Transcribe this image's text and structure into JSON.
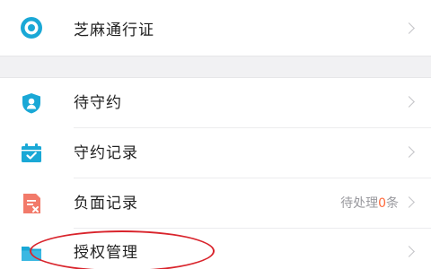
{
  "colors": {
    "accent": "#1aa8d6",
    "danger": "#f27a6a",
    "annotation": "#d9242c",
    "pending_count": "#ff6a3c"
  },
  "top_item": {
    "label": "芝麻通行证",
    "icon": "zhima-pass-icon"
  },
  "items": [
    {
      "label": "待守约",
      "icon": "shield-user-icon"
    },
    {
      "label": "守约记录",
      "icon": "calendar-check-icon"
    },
    {
      "label": "负面记录",
      "icon": "document-error-icon",
      "meta_prefix": "待处理",
      "meta_count": "0",
      "meta_suffix": "条"
    },
    {
      "label": "授权管理",
      "icon": "folder-icon"
    }
  ]
}
